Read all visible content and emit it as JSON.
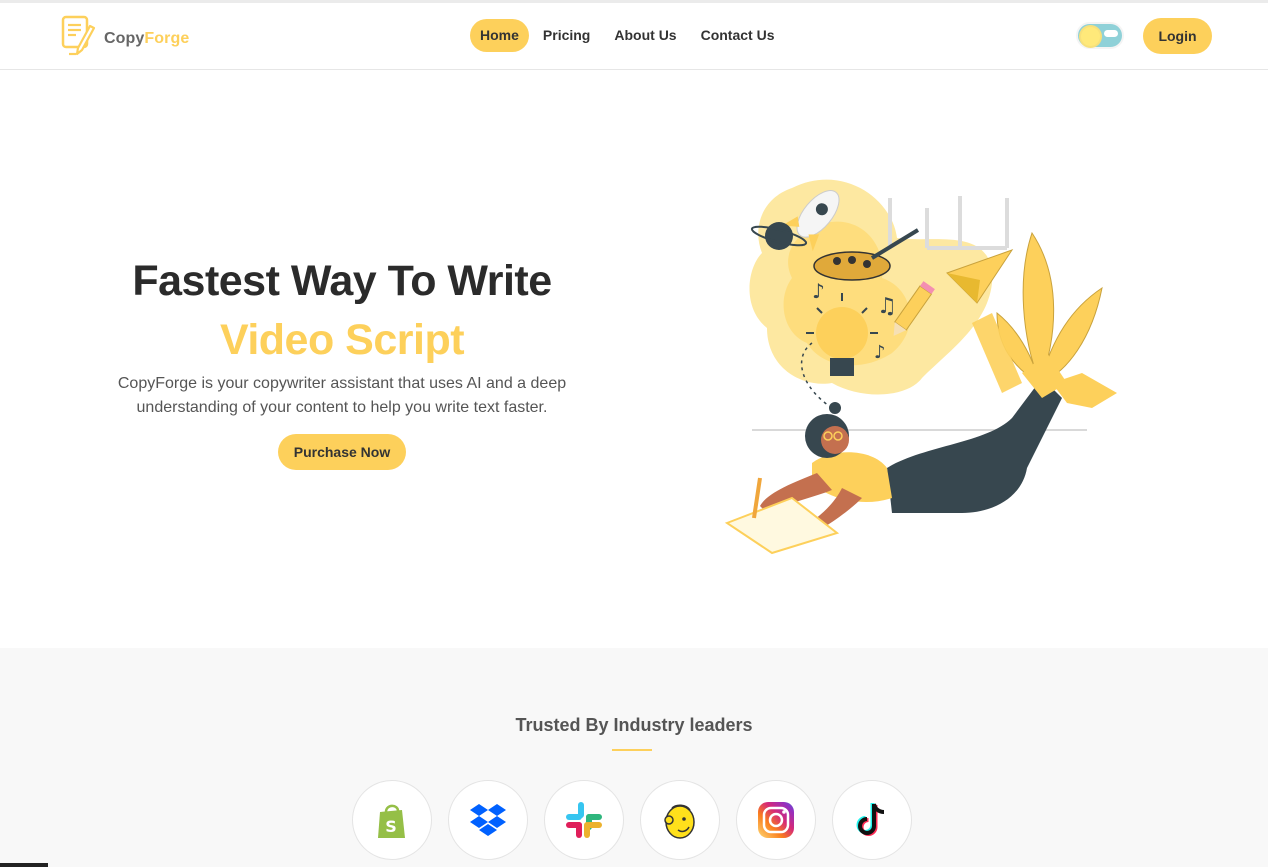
{
  "header": {
    "logo": {
      "name_part1": "Copy",
      "name_part2": "Forge",
      "icon": "document-pen-icon"
    },
    "nav": [
      {
        "label": "Home",
        "active": true
      },
      {
        "label": "Pricing",
        "active": false
      },
      {
        "label": "About Us",
        "active": false
      },
      {
        "label": "Contact Us",
        "active": false
      }
    ],
    "theme_toggle": {
      "state": "light",
      "icon": "sun-cloud-icon"
    },
    "login_label": "Login"
  },
  "hero": {
    "title": "Fastest Way To Write",
    "accent": "Video Script",
    "description": "CopyForge is your copywriter assistant that uses AI and a deep understanding of your content to help you write text faster.",
    "cta_label": "Purchase Now",
    "illustration": "woman-writing-with-ideas-illustration"
  },
  "trusted": {
    "title": "Trusted By Industry leaders",
    "brands": [
      "Shopify",
      "Dropbox",
      "Slack",
      "Mailchimp",
      "Instagram",
      "TikTok"
    ]
  },
  "colors": {
    "accent": "#fdd05b",
    "text_dark": "#2b2b2b",
    "text_muted": "#555555",
    "section_bg": "#f8f8f8",
    "toggle_bg": "#8fd1d8"
  }
}
